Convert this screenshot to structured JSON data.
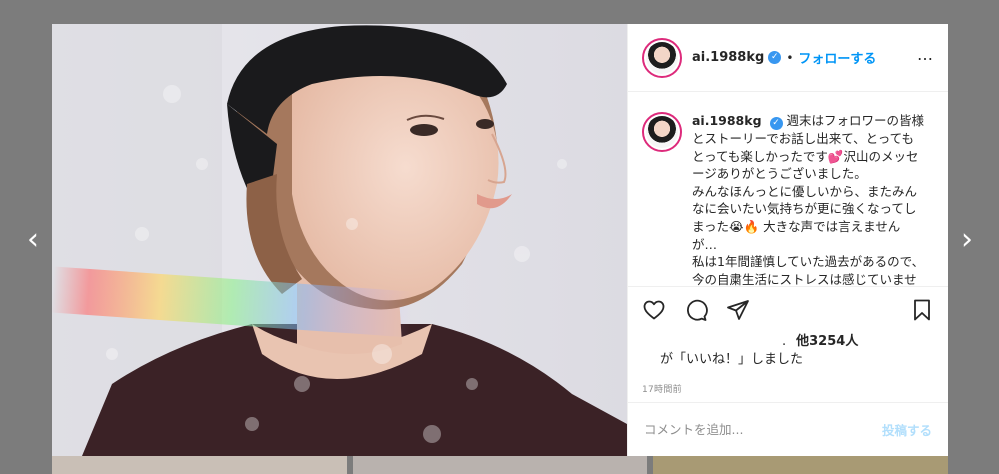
{
  "post": {
    "username": "ai.1988kg",
    "verified_symbol": "✓",
    "dot": "•",
    "follow_label": "フォローする",
    "more_symbol": "…",
    "caption_lines": [
      "週末はフォロワーの皆様",
      "とストーリーでお話し出来て、とっても",
      "とっても楽しかったです💕沢山のメッセ",
      "ージありがとうございました。",
      "みんなほんっとに優しいから、またみん",
      "なに会いたい気持ちが更に強くなってし",
      "まった😭🔥 大きな声では言えません",
      "が…",
      "私は1年間謹慎していた過去があるので、",
      "今の自粛生活にストレスは感じていませ"
    ],
    "likes_count": "他3254人",
    "likes_suffix": "が「いいね！」しました",
    "likes_dot": ".",
    "timestamp": "17時間前",
    "comment_placeholder": "コメントを追加...",
    "post_button": "投稿する"
  },
  "nav": {
    "prev_symbol": "‹",
    "next_symbol": "›"
  },
  "icons": {
    "like": "heart-icon",
    "comment": "comment-icon",
    "share": "paper-plane-icon",
    "save": "bookmark-icon"
  },
  "colors": {
    "accent": "#0095f6",
    "post_disabled": "#b2dffc",
    "overlay": "#7c7c7c"
  }
}
